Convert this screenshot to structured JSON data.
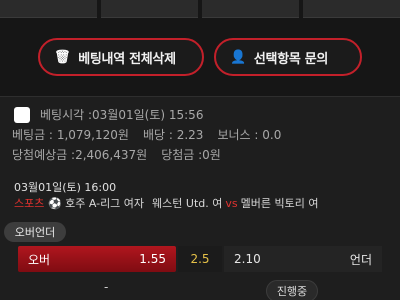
{
  "actions": {
    "delete_all_label": "베팅내역 전체삭제",
    "inquiry_label": "선택항목 문의"
  },
  "bet": {
    "time_label": "베팅시각 :",
    "time_value": "03월01일(토) 15:56",
    "amount_label": "베팅금 :",
    "amount_value": "1,079,120원",
    "odds_label": "배당 :",
    "odds_value": "2.23",
    "bonus_label": "보너스 :",
    "bonus_value": "0.0",
    "expected_label": "당첨예상금 :",
    "expected_value": "2,406,437원",
    "won_label": "당첨금 :",
    "won_value": "0원"
  },
  "match": {
    "datetime": "03월01일(토) 16:00",
    "sport": "스포츠",
    "league": "호주 A-리그 여자",
    "home": "웨스턴 Utd. 여",
    "vs": "vs",
    "away": "멜버른 빅토리 여",
    "market": "오버언더",
    "over_label": "오버",
    "over_odds": "1.55",
    "line": "2.5",
    "under_odds": "2.10",
    "under_label": "언더",
    "result": "-",
    "status": "진행중"
  },
  "icons": {
    "trash": "trash-icon",
    "user": "user-icon",
    "ball": "soccer-ball-icon"
  },
  "colors": {
    "accent": "#c3202a",
    "background": "#161616",
    "line_color": "#e4c048"
  }
}
